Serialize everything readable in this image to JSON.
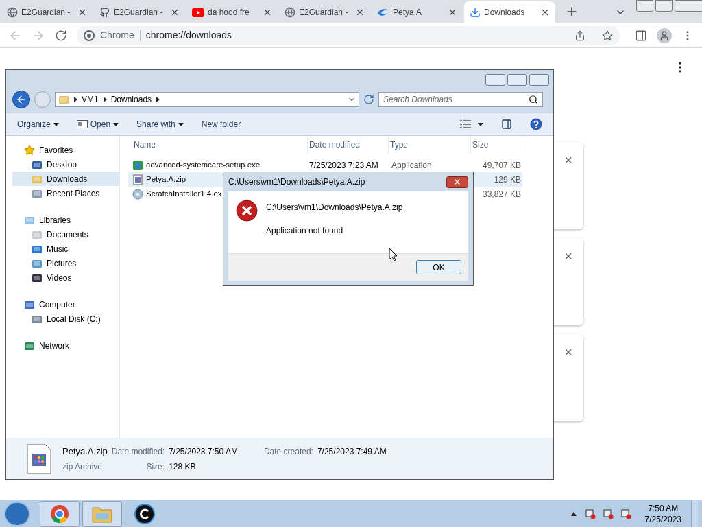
{
  "browser": {
    "tabs": [
      {
        "label": "E2Guardian -",
        "selected": false
      },
      {
        "label": "E2Guardian -",
        "selected": false
      },
      {
        "label": "da hood fre",
        "selected": false
      },
      {
        "label": "E2Guardian -",
        "selected": false
      },
      {
        "label": "Petya.A",
        "selected": false
      },
      {
        "label": "Downloads",
        "selected": true
      }
    ],
    "omnibox": {
      "site": "Chrome",
      "url": "chrome://downloads"
    },
    "page": {
      "cards": [
        {
          "close": "×"
        },
        {
          "close": "×"
        },
        {
          "close": "×"
        }
      ]
    }
  },
  "explorer": {
    "breadcrumbs": [
      "VM1",
      "Downloads"
    ],
    "search_placeholder": "Search Downloads",
    "toolbar": [
      "Organize",
      "Open",
      "Share with",
      "New folder"
    ],
    "nav": [
      {
        "label": "Favorites",
        "selected": false,
        "children": [
          {
            "label": "Desktop",
            "selected": false
          },
          {
            "label": "Downloads",
            "selected": true
          },
          {
            "label": "Recent Places",
            "selected": false
          }
        ]
      },
      {
        "label": "Libraries",
        "selected": false,
        "children": [
          {
            "label": "Documents",
            "selected": false
          },
          {
            "label": "Music",
            "selected": false
          },
          {
            "label": "Pictures",
            "selected": false
          },
          {
            "label": "Videos",
            "selected": false
          }
        ]
      },
      {
        "label": "Computer",
        "selected": false,
        "children": [
          {
            "label": "Local Disk (C:)",
            "selected": false
          }
        ]
      },
      {
        "label": "Network",
        "selected": false
      }
    ],
    "columns": [
      "Name",
      "Date modified",
      "Type",
      "Size"
    ],
    "rows": [
      {
        "name": "advanced-systemcare-setup.exe",
        "date": "7/25/2023 7:23 AM",
        "type": "Application",
        "size": "49,707 KB",
        "selected": false
      },
      {
        "name": "Petya.A.zip",
        "size": "129 KB",
        "selected": true
      },
      {
        "name": "ScratchInstaller1.4.ex",
        "size": "33,827 KB",
        "selected": false
      }
    ],
    "details": {
      "name": "Petya.A.zip",
      "kind": "zip Archive",
      "modified_label": "Date modified:",
      "modified": "7/25/2023 7:50 AM",
      "size_label": "Size:",
      "size": "128 KB",
      "created_label": "Date created:",
      "created": "7/25/2023 7:49 AM"
    }
  },
  "dialog": {
    "title": "C:\\Users\\vm1\\Downloads\\Petya.A.zip",
    "path": "C:\\Users\\vm1\\Downloads\\Petya.A.zip",
    "message": "Application not found",
    "button": "OK"
  },
  "taskbar": {
    "time": "7:50 AM",
    "date": "7/25/2023"
  }
}
